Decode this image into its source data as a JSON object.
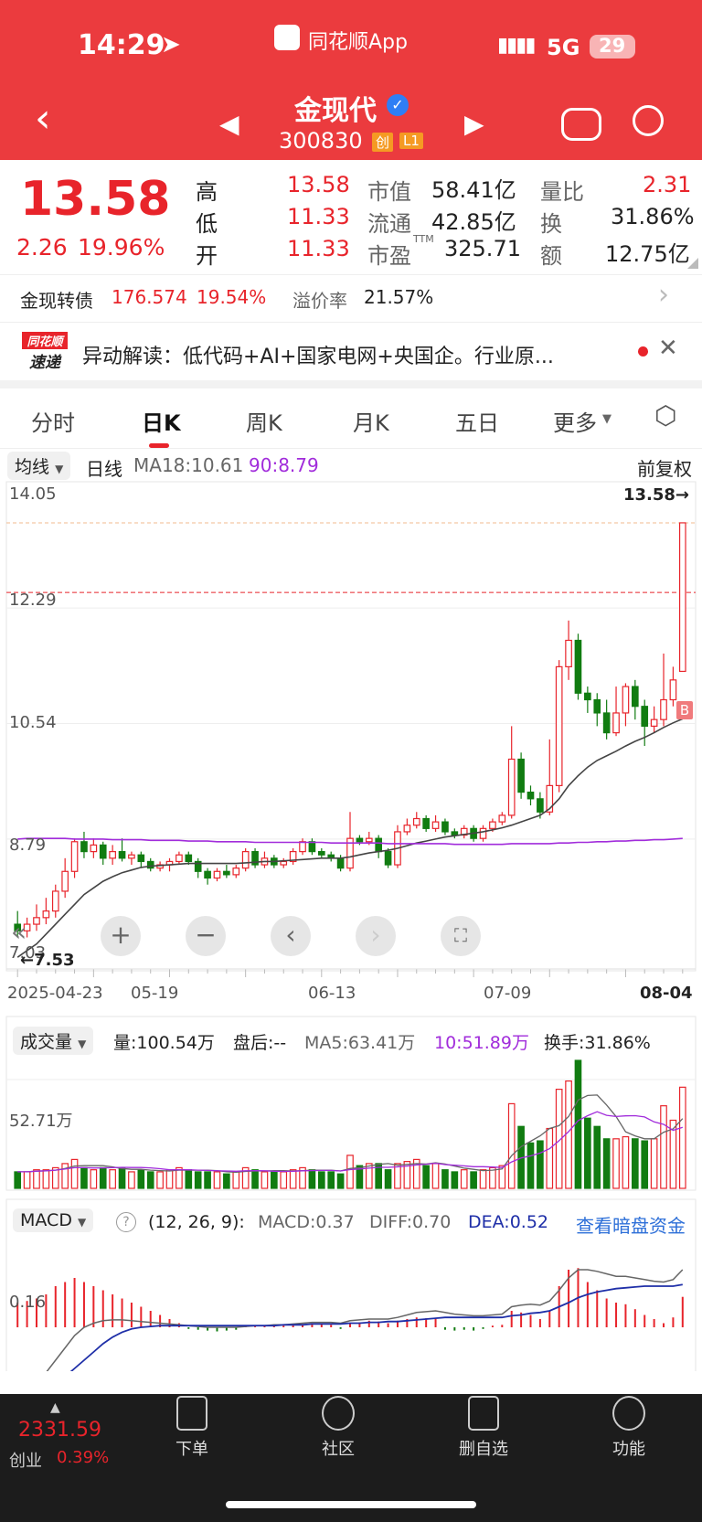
{
  "status_bar": {
    "time": "14:29",
    "app_name": "同花顺App",
    "network": "5G",
    "battery": "29"
  },
  "nav": {
    "stock_name": "金现代",
    "stock_code": "300830",
    "badge_chuang": "创",
    "badge_l1": "L1"
  },
  "quote": {
    "price": "13.58",
    "change": "2.26",
    "change_pct": "19.96%",
    "items": [
      {
        "label": "高",
        "value": "13.58",
        "color": "red"
      },
      {
        "label": "低",
        "value": "11.33",
        "color": "red"
      },
      {
        "label": "开",
        "value": "11.33",
        "color": "red"
      },
      {
        "label": "市值",
        "value": "58.41亿"
      },
      {
        "label": "流通",
        "value": "42.85亿"
      },
      {
        "label": "市盈",
        "sup": "TTM",
        "value": "325.71"
      },
      {
        "label": "量比",
        "value": "2.31",
        "color": "red"
      },
      {
        "label": "换",
        "value": "31.86%"
      },
      {
        "label": "额",
        "value": "12.75亿"
      }
    ]
  },
  "bond": {
    "name": "金现转债",
    "price": "176.574",
    "pct": "19.54%",
    "premium_label": "溢价率",
    "premium": "21.57%"
  },
  "news": {
    "logo_top": "同花顺",
    "logo_bottom": "速递",
    "text": "异动解读：低代码+AI+国家电网+央国企。行业原..."
  },
  "tabs": [
    "分时",
    "日K",
    "周K",
    "月K",
    "五日",
    "更多"
  ],
  "active_tab": "日K",
  "kline_header": {
    "selector": "均线",
    "period": "日线",
    "ma18": "MA18:10.61",
    "ma90": "90:8.79",
    "adjust": "前复权"
  },
  "price_axis": [
    "14.05",
    "12.29",
    "10.54",
    "8.79",
    "7.03"
  ],
  "last_price_marker": "13.58→",
  "low_marker": "←7.53",
  "buy_marker": "B",
  "date_axis": [
    "2025-04-23",
    "05-19",
    "06-13",
    "07-09",
    "08-04"
  ],
  "volume_header": {
    "selector": "成交量",
    "vol": "量:100.54万",
    "after": "盘后:--",
    "ma5": "MA5:63.41万",
    "ma10": "10:51.89万",
    "turnover": "换手:31.86%"
  },
  "volume_axis": "52.71万",
  "macd_header": {
    "selector": "MACD",
    "help": "?",
    "params": "(12, 26, 9):",
    "macd": "MACD:0.37",
    "diff": "DIFF:0.70",
    "dea": "DEA:0.52",
    "link": "查看暗盘资金"
  },
  "macd_axis": "0.16",
  "bottom_index": {
    "value": "2331.59",
    "name": "创业",
    "pct": "0.39%"
  },
  "bottom_nav": [
    "下单",
    "社区",
    "删自选",
    "功能"
  ],
  "colors": {
    "up": "#e8242b",
    "down": "#117c11",
    "header": "#eb3b3e",
    "ma18": "#444444",
    "ma90": "#a12cdb"
  },
  "chart_data": {
    "type": "candlestick",
    "dates": [
      "2025-04-23",
      "05-19",
      "06-13",
      "07-09",
      "08-04"
    ],
    "price_ylim": [
      7.03,
      14.05
    ],
    "candles": [
      [
        7.5,
        7.4,
        7.7,
        7.3
      ],
      [
        7.4,
        7.5,
        7.6,
        7.3
      ],
      [
        7.5,
        7.6,
        7.8,
        7.4
      ],
      [
        7.6,
        7.7,
        7.9,
        7.5
      ],
      [
        7.7,
        8.0,
        8.1,
        7.6
      ],
      [
        8.0,
        8.3,
        8.5,
        7.9
      ],
      [
        8.3,
        8.75,
        8.8,
        8.2
      ],
      [
        8.75,
        8.6,
        8.9,
        8.5
      ],
      [
        8.6,
        8.7,
        8.8,
        8.5
      ],
      [
        8.7,
        8.5,
        8.75,
        8.4
      ],
      [
        8.5,
        8.6,
        8.7,
        8.4
      ],
      [
        8.6,
        8.5,
        8.8,
        8.45
      ],
      [
        8.5,
        8.55,
        8.6,
        8.4
      ],
      [
        8.55,
        8.45,
        8.6,
        8.35
      ],
      [
        8.45,
        8.35,
        8.5,
        8.3
      ],
      [
        8.35,
        8.4,
        8.45,
        8.3
      ],
      [
        8.4,
        8.45,
        8.5,
        8.3
      ],
      [
        8.45,
        8.55,
        8.6,
        8.4
      ],
      [
        8.55,
        8.45,
        8.6,
        8.4
      ],
      [
        8.45,
        8.3,
        8.5,
        8.2
      ],
      [
        8.3,
        8.2,
        8.35,
        8.1
      ],
      [
        8.2,
        8.3,
        8.35,
        8.15
      ],
      [
        8.3,
        8.25,
        8.4,
        8.2
      ],
      [
        8.25,
        8.35,
        8.4,
        8.2
      ],
      [
        8.35,
        8.6,
        8.65,
        8.3
      ],
      [
        8.6,
        8.4,
        8.65,
        8.35
      ],
      [
        8.4,
        8.5,
        8.6,
        8.35
      ],
      [
        8.5,
        8.4,
        8.55,
        8.35
      ],
      [
        8.4,
        8.45,
        8.5,
        8.35
      ],
      [
        8.45,
        8.6,
        8.65,
        8.4
      ],
      [
        8.6,
        8.75,
        8.8,
        8.55
      ],
      [
        8.75,
        8.6,
        8.8,
        8.55
      ],
      [
        8.6,
        8.55,
        8.65,
        8.5
      ],
      [
        8.55,
        8.5,
        8.6,
        8.45
      ],
      [
        8.5,
        8.35,
        8.55,
        8.3
      ],
      [
        8.35,
        8.8,
        9.2,
        8.3
      ],
      [
        8.8,
        8.75,
        8.85,
        8.7
      ],
      [
        8.75,
        8.8,
        8.9,
        8.7
      ],
      [
        8.8,
        8.6,
        8.85,
        8.5
      ],
      [
        8.6,
        8.4,
        8.65,
        8.35
      ],
      [
        8.4,
        8.9,
        9.0,
        8.35
      ],
      [
        8.9,
        9.0,
        9.1,
        8.85
      ],
      [
        9.0,
        9.1,
        9.2,
        8.95
      ],
      [
        9.1,
        8.95,
        9.15,
        8.9
      ],
      [
        8.95,
        9.05,
        9.15,
        8.9
      ],
      [
        9.05,
        8.9,
        9.1,
        8.85
      ],
      [
        8.9,
        8.85,
        8.95,
        8.8
      ],
      [
        8.85,
        8.95,
        9.0,
        8.8
      ],
      [
        8.95,
        8.8,
        9.0,
        8.75
      ],
      [
        8.8,
        8.95,
        9.0,
        8.75
      ],
      [
        8.95,
        9.05,
        9.1,
        8.9
      ],
      [
        9.05,
        9.15,
        9.2,
        9.0
      ],
      [
        9.15,
        10.0,
        10.5,
        9.1
      ],
      [
        10.0,
        9.5,
        10.1,
        9.4
      ],
      [
        9.5,
        9.4,
        9.6,
        9.3
      ],
      [
        9.4,
        9.2,
        9.5,
        9.1
      ],
      [
        9.2,
        9.6,
        10.3,
        9.15
      ],
      [
        9.6,
        11.4,
        11.5,
        9.5
      ],
      [
        11.4,
        11.8,
        12.1,
        11.2
      ],
      [
        11.8,
        11.0,
        11.9,
        10.9
      ],
      [
        11.0,
        10.9,
        11.1,
        10.7
      ],
      [
        10.9,
        10.7,
        11.0,
        10.5
      ],
      [
        10.7,
        10.4,
        10.9,
        10.3
      ],
      [
        10.4,
        10.7,
        11.1,
        10.35
      ],
      [
        10.7,
        11.1,
        11.15,
        10.5
      ],
      [
        11.1,
        10.8,
        11.2,
        10.6
      ],
      [
        10.8,
        10.5,
        10.9,
        10.2
      ],
      [
        10.5,
        10.6,
        10.8,
        10.4
      ],
      [
        10.6,
        10.9,
        11.6,
        10.5
      ],
      [
        10.9,
        11.2,
        11.4,
        10.8
      ],
      [
        11.33,
        13.58,
        13.58,
        11.33
      ]
    ],
    "ma18": [
      7.0,
      7.1,
      7.2,
      7.35,
      7.5,
      7.65,
      7.8,
      7.95,
      8.05,
      8.15,
      8.22,
      8.28,
      8.32,
      8.36,
      8.38,
      8.39,
      8.4,
      8.41,
      8.42,
      8.42,
      8.42,
      8.42,
      8.42,
      8.42,
      8.43,
      8.44,
      8.45,
      8.45,
      8.46,
      8.47,
      8.48,
      8.49,
      8.5,
      8.5,
      8.5,
      8.52,
      8.55,
      8.58,
      8.6,
      8.62,
      8.65,
      8.69,
      8.73,
      8.76,
      8.79,
      8.82,
      8.84,
      8.86,
      8.88,
      8.9,
      8.93,
      8.96,
      9.0,
      9.05,
      9.1,
      9.15,
      9.25,
      9.4,
      9.6,
      9.75,
      9.88,
      9.98,
      10.05,
      10.12,
      10.2,
      10.27,
      10.33,
      10.4,
      10.48,
      10.55,
      10.61
    ],
    "ma90": [
      8.79,
      8.8,
      8.8,
      8.8,
      8.8,
      8.8,
      8.79,
      8.79,
      8.79,
      8.79,
      8.78,
      8.78,
      8.78,
      8.78,
      8.77,
      8.77,
      8.77,
      8.77,
      8.76,
      8.76,
      8.76,
      8.75,
      8.75,
      8.75,
      8.75,
      8.74,
      8.74,
      8.74,
      8.74,
      8.74,
      8.74,
      8.74,
      8.74,
      8.73,
      8.73,
      8.73,
      8.73,
      8.73,
      8.73,
      8.72,
      8.72,
      8.72,
      8.72,
      8.72,
      8.72,
      8.72,
      8.71,
      8.71,
      8.71,
      8.71,
      8.71,
      8.71,
      8.72,
      8.72,
      8.72,
      8.72,
      8.72,
      8.73,
      8.73,
      8.74,
      8.74,
      8.75,
      8.75,
      8.76,
      8.76,
      8.77,
      8.77,
      8.78,
      8.78,
      8.79,
      8.8
    ],
    "volume_axis_value": 52.71,
    "volumes": [
      8,
      8,
      9,
      9,
      10,
      12,
      14,
      10,
      9,
      10,
      9,
      10,
      8,
      9,
      8,
      8,
      9,
      10,
      9,
      8,
      8,
      8,
      7,
      8,
      10,
      9,
      8,
      8,
      8,
      9,
      10,
      9,
      8,
      8,
      7,
      16,
      11,
      12,
      12,
      9,
      12,
      13,
      14,
      11,
      12,
      9,
      8,
      9,
      8,
      9,
      10,
      11,
      41,
      30,
      22,
      23,
      29,
      48,
      52,
      62,
      34,
      30,
      24,
      24,
      25,
      24,
      23,
      24,
      40,
      33,
      49
    ],
    "macd_bars": [
      0.3,
      0.32,
      0.35,
      0.4,
      0.5,
      0.55,
      0.6,
      0.55,
      0.5,
      0.45,
      0.4,
      0.35,
      0.3,
      0.25,
      0.2,
      0.15,
      0.1,
      0.05,
      -0.02,
      -0.03,
      -0.04,
      -0.05,
      -0.04,
      -0.03,
      0.02,
      0.01,
      0.02,
      0.03,
      0.02,
      0.03,
      0.04,
      0.05,
      0.04,
      0.03,
      -0.02,
      0.05,
      0.06,
      0.08,
      0.07,
      0.05,
      0.08,
      0.1,
      0.12,
      0.11,
      0.1,
      -0.03,
      -0.04,
      -0.03,
      -0.04,
      -0.02,
      0.02,
      0.03,
      0.2,
      0.18,
      0.15,
      0.1,
      0.2,
      0.5,
      0.7,
      0.72,
      0.55,
      0.45,
      0.35,
      0.3,
      0.28,
      0.22,
      0.15,
      0.1,
      0.05,
      0.12,
      0.37
    ],
    "diff": [
      -0.8,
      -0.75,
      -0.68,
      -0.55,
      -0.4,
      -0.25,
      -0.1,
      0.0,
      0.05,
      0.08,
      0.09,
      0.09,
      0.08,
      0.07,
      0.06,
      0.05,
      0.04,
      0.03,
      0.02,
      0.01,
      0.0,
      0.0,
      0.0,
      0.0,
      0.01,
      0.02,
      0.02,
      0.03,
      0.03,
      0.04,
      0.05,
      0.06,
      0.06,
      0.06,
      0.05,
      0.08,
      0.09,
      0.1,
      0.1,
      0.1,
      0.12,
      0.15,
      0.18,
      0.19,
      0.2,
      0.18,
      0.16,
      0.15,
      0.14,
      0.14,
      0.15,
      0.16,
      0.25,
      0.27,
      0.28,
      0.27,
      0.32,
      0.45,
      0.6,
      0.7,
      0.7,
      0.68,
      0.65,
      0.62,
      0.62,
      0.6,
      0.58,
      0.56,
      0.55,
      0.58,
      0.7
    ],
    "dea": [
      -0.9,
      -0.87,
      -0.83,
      -0.78,
      -0.7,
      -0.6,
      -0.5,
      -0.4,
      -0.3,
      -0.2,
      -0.12,
      -0.06,
      -0.02,
      0.0,
      0.01,
      0.02,
      0.02,
      0.02,
      0.02,
      0.02,
      0.02,
      0.02,
      0.02,
      0.02,
      0.02,
      0.02,
      0.02,
      0.02,
      0.03,
      0.03,
      0.03,
      0.04,
      0.04,
      0.04,
      0.04,
      0.05,
      0.05,
      0.06,
      0.06,
      0.07,
      0.07,
      0.08,
      0.09,
      0.1,
      0.11,
      0.12,
      0.12,
      0.12,
      0.12,
      0.12,
      0.12,
      0.12,
      0.14,
      0.15,
      0.17,
      0.18,
      0.2,
      0.25,
      0.3,
      0.36,
      0.4,
      0.43,
      0.45,
      0.47,
      0.48,
      0.49,
      0.5,
      0.5,
      0.5,
      0.5,
      0.52
    ]
  }
}
